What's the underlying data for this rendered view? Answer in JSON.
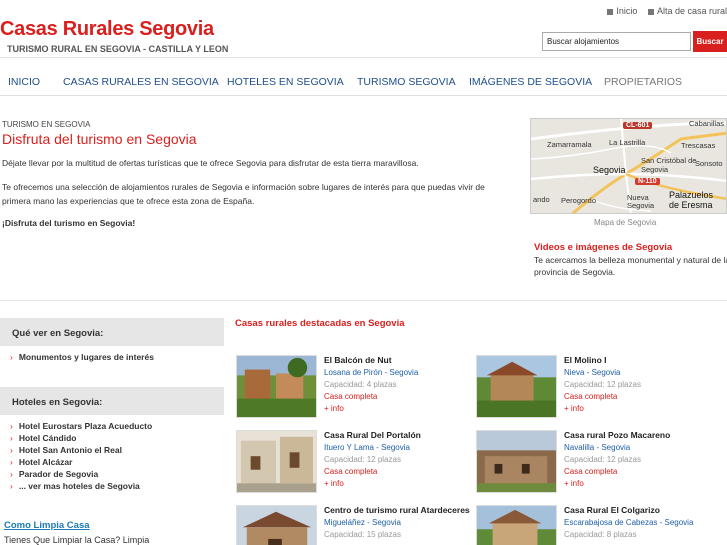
{
  "header": {
    "title": "Casas Rurales Segovia",
    "subtitle": "TURISMO RURAL EN SEGOVIA - CASTILLA Y LEON",
    "top_links": [
      "Inicio",
      "Alta de casa rural"
    ],
    "search_value": "Buscar alojamientos",
    "search_button": "Buscar"
  },
  "nav": [
    "INICIO",
    "CASAS RURALES EN SEGOVIA",
    "HOTELES EN SEGOVIA",
    "TURISMO SEGOVIA",
    "IMÁGENES DE SEGOVIA",
    "PROPIETARIOS"
  ],
  "intro": {
    "breadcrumb": "TURISMO EN SEGOVIA",
    "title": "Disfruta del turismo en Segovia",
    "p1": "Déjate llevar por la multitud de ofertas turísticas que te ofrece Segovia para disfrutar de esta tierra maravillosa.",
    "p2": "Te ofrecemos una selección de alojamientos rurales de Segovia e información sobre lugares de interés para que puedas vivir de primera mano las experiencias que te ofrece esta zona de España.",
    "p3": "¡Disfruta del turismo en Segovia!"
  },
  "map": {
    "labels": [
      "Cabanillas del Monte",
      "Zamarramala",
      "La Lastrilla",
      "Trescasas",
      "San Cristóbal de Segovia",
      "Sonsoto",
      "Segovia",
      "Palazuelos de Eresma",
      "Perogordo",
      "Nueva Segovia",
      "ando"
    ],
    "roads": [
      "CL-601",
      "N-110"
    ],
    "caption": "Mapa de Segovia"
  },
  "videos": {
    "title": "Videos e imágenes de Segovia",
    "text": "Te acercamos la belleza monumental y natural de la provincia de Segovia."
  },
  "sidebar": {
    "que_ver_title": "Qué ver en Segovia:",
    "que_ver_links": [
      "Monumentos y lugares de interés"
    ],
    "hoteles_title": "Hoteles en Segovia:",
    "hoteles_links": [
      "Hotel Eurostars Plaza Acueducto",
      "Hotel Cándido",
      "Hotel San Antonio el Real",
      "Hotel Alcázar",
      "Parador de Segovia",
      "... ver mas hoteles de Segovia"
    ],
    "ad_title": "Como Limpia Casa",
    "ad_text": "Tienes Que Limpiar la Casa? Limpia"
  },
  "listings": {
    "title": "Casas rurales destacadas en Segovia",
    "items": [
      {
        "name": "El Balcón de Nut",
        "location": "Losana de Pirón - Segovia",
        "capacity": "Capacidad: 4 plazas",
        "status": "Casa completa",
        "more": "+ info"
      },
      {
        "name": "El Molino I",
        "location": "Nieva - Segovia",
        "capacity": "Capacidad: 12 plazas",
        "status": "Casa completa",
        "more": "+ info"
      },
      {
        "name": "Casa Rural Del Portalón",
        "location": "Ituero Y Lama - Segovia",
        "capacity": "Capacidad: 12 plazas",
        "status": "Casa completa",
        "more": "+ info"
      },
      {
        "name": "Casa rural Pozo Macareno",
        "location": "Navalilla - Segovia",
        "capacity": "Capacidad: 12 plazas",
        "status": "Casa completa",
        "more": "+ info"
      },
      {
        "name": "Centro de turismo rural Atardeceres",
        "location": "Migueláñez - Segovia",
        "capacity": "Capacidad: 15 plazas",
        "status": "",
        "more": ""
      },
      {
        "name": "Casa Rural El Colgarizo",
        "location": "Escarabajosa de Cabezas - Segovia",
        "capacity": "Capacidad: 8 plazas",
        "status": "",
        "more": ""
      }
    ]
  },
  "colors": {
    "brand_red": "#d9201e",
    "nav_blue": "#1f4e8c",
    "link_blue": "#1f5fa8"
  }
}
